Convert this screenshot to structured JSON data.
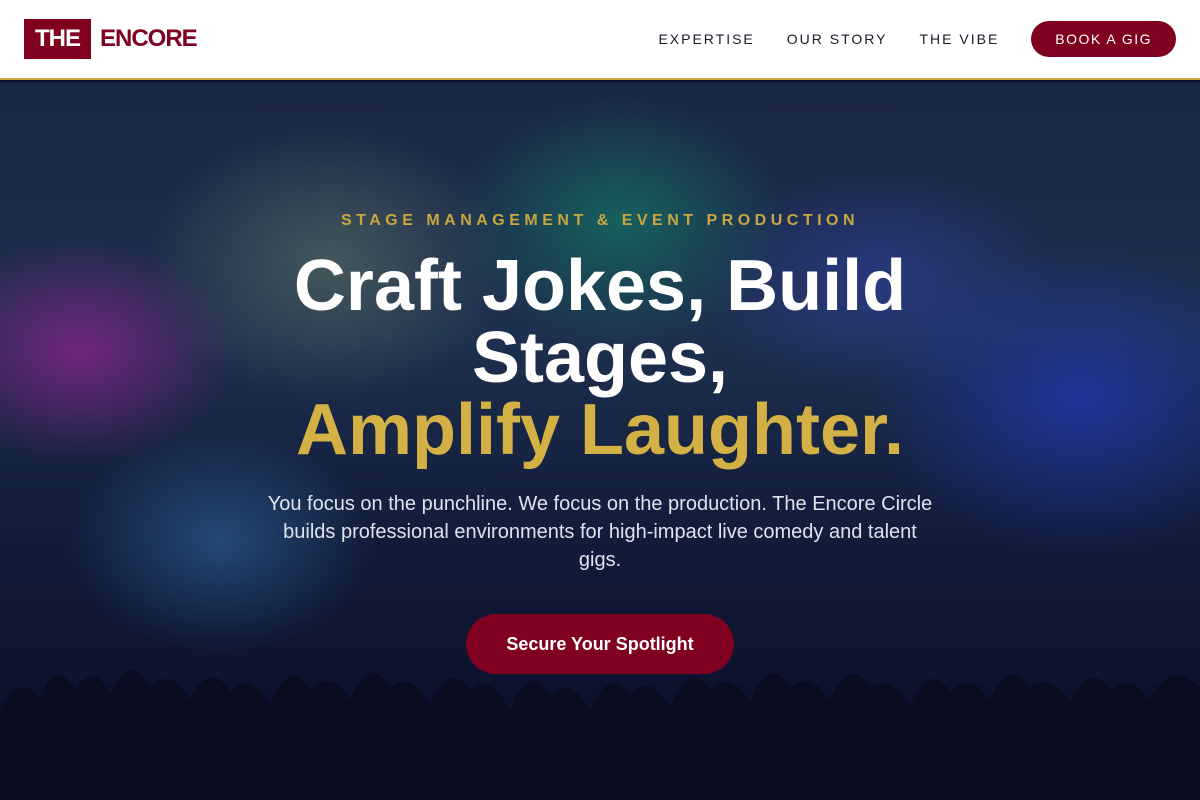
{
  "brand": {
    "logo_box_text": "THE",
    "logo_word": "ENCORE"
  },
  "nav": {
    "links": [
      "EXPERTISE",
      "OUR STORY",
      "THE VIBE"
    ],
    "cta_label": "BOOK A GIG"
  },
  "hero": {
    "eyebrow": "STAGE MANAGEMENT & EVENT PRODUCTION",
    "headline_line1": "Craft Jokes, Build",
    "headline_line2": "Stages,",
    "headline_accent": "Amplify Laughter.",
    "subtext": "You focus on the punchline. We focus on the production. The Encore Circle builds professional environments for high-impact live comedy and talent gigs.",
    "cta_label": "Secure Your Spotlight",
    "background_image": "concert-crowd-stage-lights-photo"
  },
  "colors": {
    "brand_primary": "#800020",
    "accent_gold": "#d4b144",
    "header_border": "#c9a640"
  }
}
